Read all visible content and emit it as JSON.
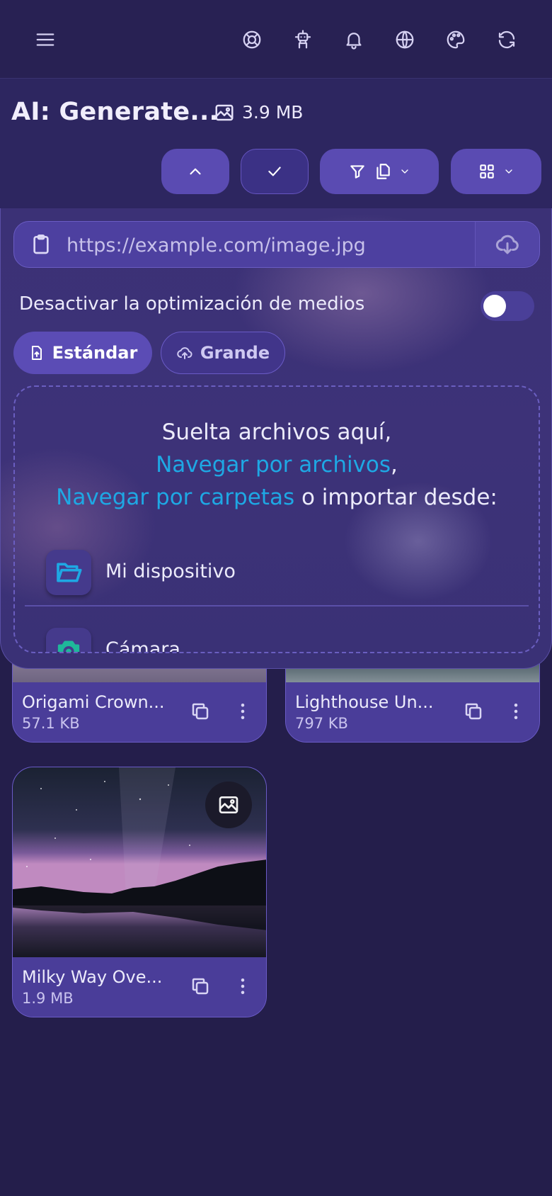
{
  "topbar": {
    "icons": [
      "menu-icon",
      "help-icon",
      "robot-icon",
      "bell-icon",
      "globe-icon",
      "palette-icon",
      "refresh-icon"
    ]
  },
  "header": {
    "title": "AI: Generate...",
    "total_size": "3.9 MB",
    "size_icon": "image-icon"
  },
  "toolbar": {
    "buttons": [
      "chevron-up-icon",
      "check-icon",
      "filter-copy-dropdown",
      "grid-view-dropdown"
    ]
  },
  "import_panel": {
    "url_placeholder": "https://example.com/image.jpg",
    "url_value": "",
    "optimization_label": "Desactivar la optimización de medios",
    "optimization_toggle_on": false,
    "mode_standard": "Estándar",
    "mode_large": "Grande",
    "drop_text_1": "Suelta archivos aquí,",
    "browse_files_link": "Navegar por archivos",
    "comma": ",",
    "browse_folders_link": "Navegar por carpetas",
    "import_from_text": " o importar desde:",
    "sources": [
      {
        "label": "Mi dispositivo",
        "icon": "folder-open-icon",
        "color": "#1ea8e4"
      },
      {
        "label": "Cámara",
        "icon": "camera-icon",
        "color": "#1fb89a"
      }
    ]
  },
  "files": [
    {
      "name": "Origami Crown...",
      "size": "57.1 KB"
    },
    {
      "name": "Lighthouse Un...",
      "size": "797 KB"
    },
    {
      "name": "Milky Way Ove...",
      "size": "1.9 MB"
    }
  ],
  "colors": {
    "background": "#241e4b",
    "accent": "#5a4bb2",
    "link": "#1ea8e4"
  }
}
